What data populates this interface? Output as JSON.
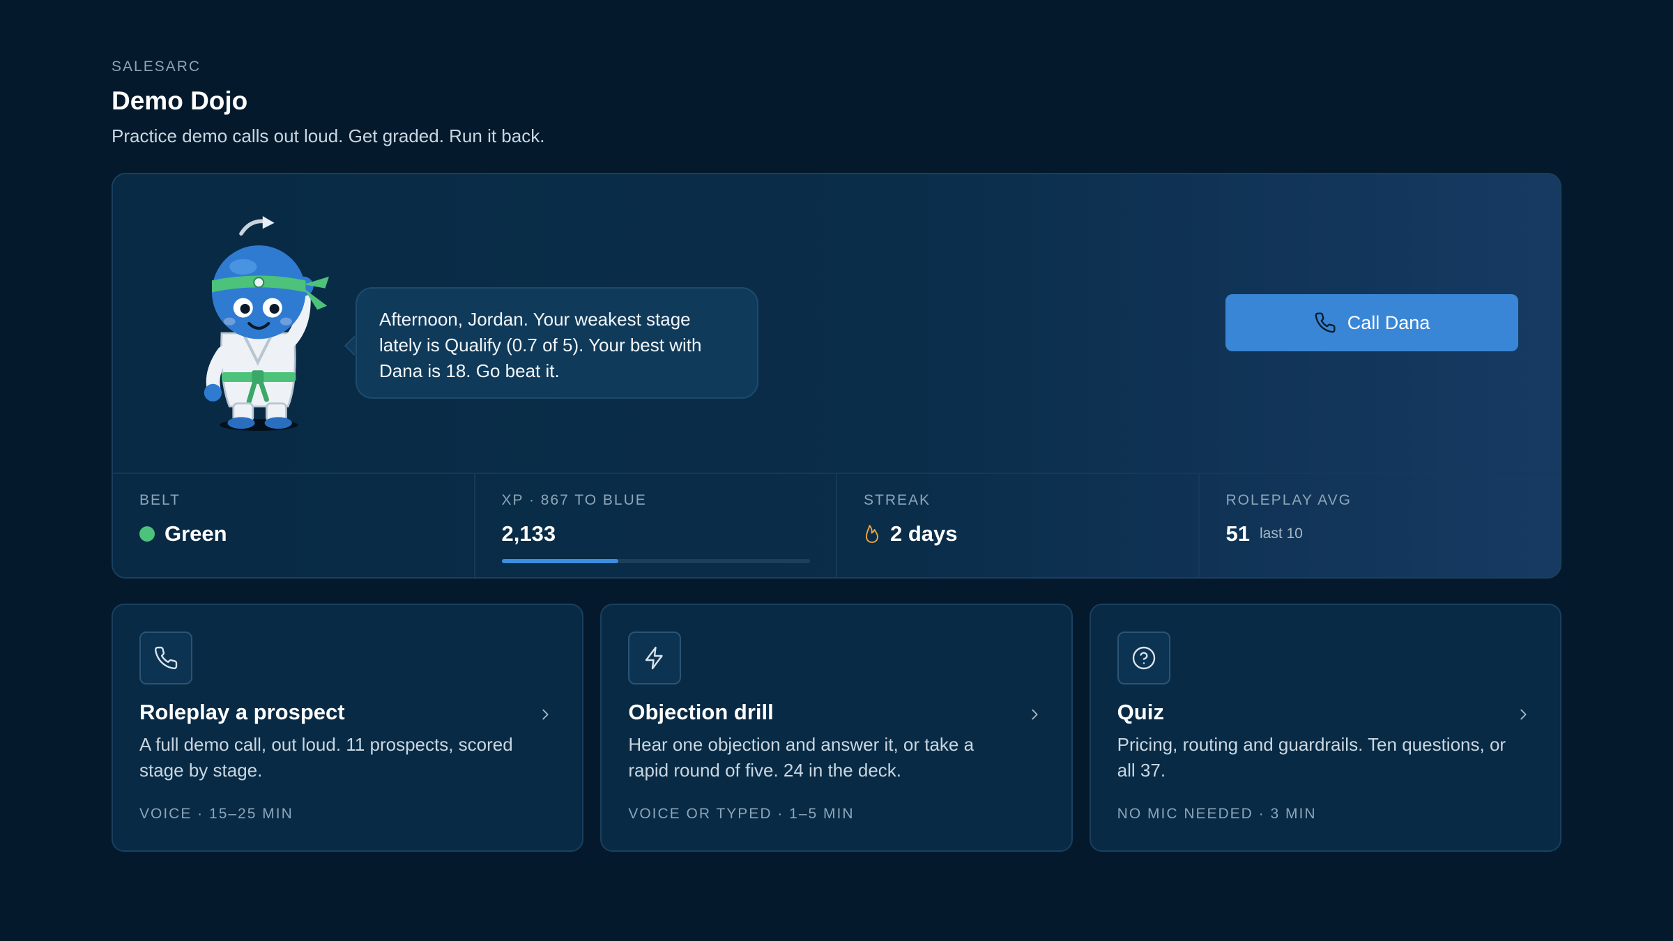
{
  "header": {
    "eyebrow": "SALESARC",
    "title": "Demo Dojo",
    "subtitle": "Practice demo calls out loud. Get graded. Run it back."
  },
  "hero": {
    "message": "Afternoon, Jordan. Your weakest stage lately is Qualify (0.7 of 5). Your best with Dana is 18. Go beat it.",
    "call_button": "Call Dana",
    "mascot_icon": "ninja-blob-mascot",
    "mascot_belt_color": "#4cc27a"
  },
  "stats": {
    "belt": {
      "label": "BELT",
      "value": "Green",
      "color": "#4cc27a"
    },
    "xp": {
      "label": "XP · 867 TO BLUE",
      "value": "2,133",
      "progress": 0.38
    },
    "streak": {
      "label": "STREAK",
      "value": "2 days",
      "icon": "flame-icon"
    },
    "roleplay": {
      "label": "ROLEPLAY AVG",
      "value": "51",
      "suffix": "last 10"
    }
  },
  "cards": [
    {
      "icon": "phone-icon",
      "title": "Roleplay a prospect",
      "description": "A full demo call, out loud. 11 prospects, scored stage by stage.",
      "meta": "VOICE · 15–25 MIN"
    },
    {
      "icon": "lightning-icon",
      "title": "Objection drill",
      "description": "Hear one objection and answer it, or take a rapid round of five. 24 in the deck.",
      "meta": "VOICE OR TYPED · 1–5 MIN"
    },
    {
      "icon": "question-icon",
      "title": "Quiz",
      "description": "Pricing, routing and guardrails. Ten questions, or all 37.",
      "meta": "NO MIC NEEDED · 3 MIN"
    }
  ],
  "colors": {
    "accent": "#3a86d6",
    "background": "#041a2c",
    "card": "#082a44"
  }
}
